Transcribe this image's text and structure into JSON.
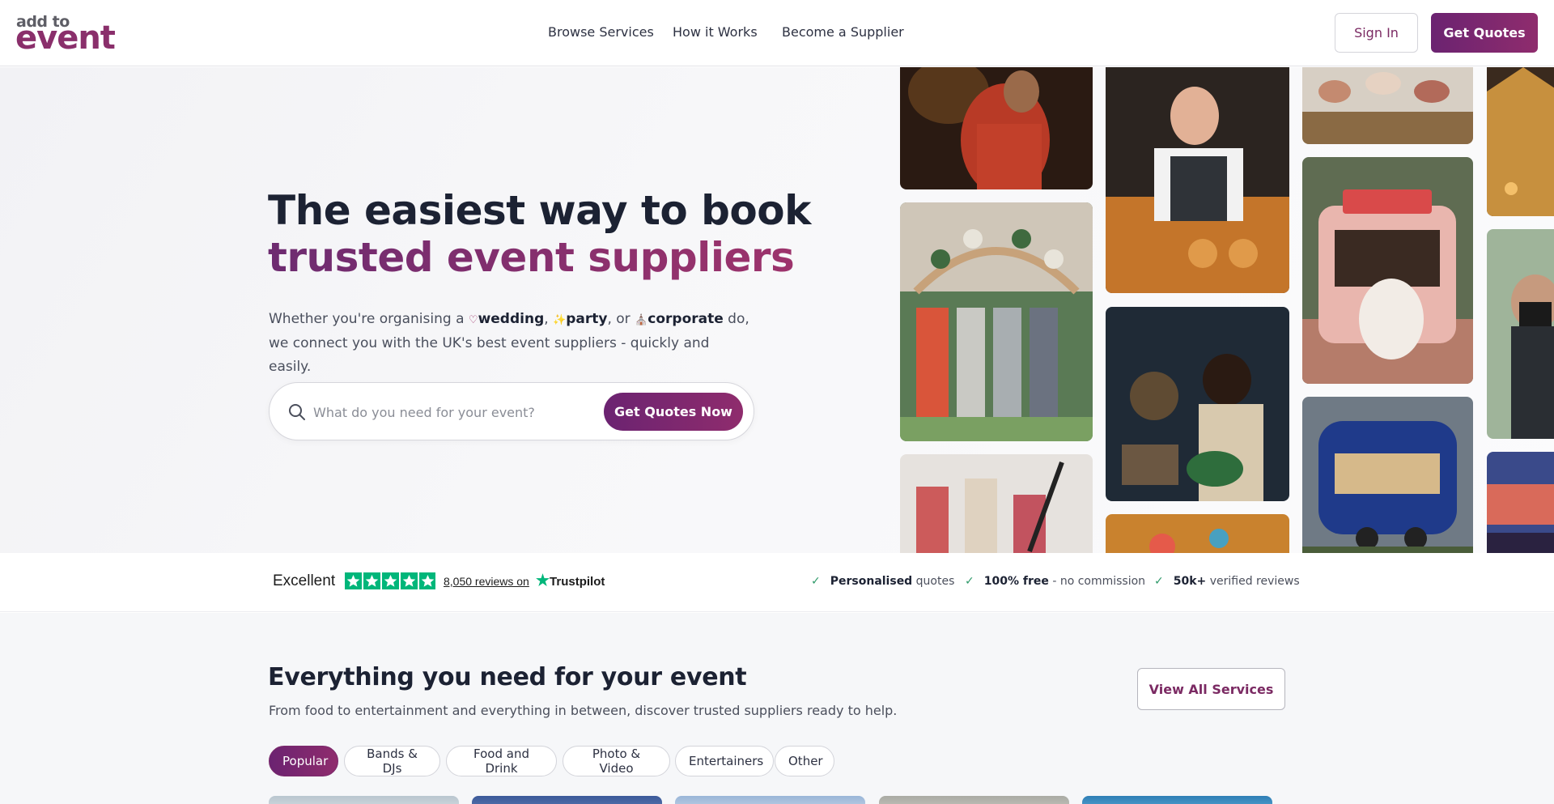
{
  "header": {
    "logo_top": "add to",
    "logo_bottom": "event",
    "nav": [
      "Browse Services",
      "How it Works",
      "Become a Supplier"
    ],
    "sign_in": "Sign In",
    "get_quotes": "Get Quotes"
  },
  "hero": {
    "title_line1": "The easiest way to book",
    "title_line2": "trusted event suppliers",
    "sub_part1": "Whether you're organising a",
    "kw_wedding": "wedding",
    "comma1": ",",
    "kw_party": "party",
    "sub_part2": ", or",
    "kw_corporate": "corporate",
    "sub_part3": "do, we connect you with the UK's best event suppliers - quickly and easily.",
    "search_placeholder": "What do you need for your event?",
    "search_button": "Get Quotes Now",
    "icons": [
      "heart-icon",
      "party-popper-icon",
      "building-icon",
      "search-icon"
    ]
  },
  "trust": {
    "rating_word": "Excellent",
    "reviews": "8,050 reviews on",
    "brand": "Trustpilot",
    "features": [
      {
        "bold": "Personalised",
        "rest": "quotes"
      },
      {
        "bold": "100% free",
        "rest": "- no commission"
      },
      {
        "bold": "50k+",
        "rest": "verified reviews"
      }
    ]
  },
  "services": {
    "title": "Everything you need for your event",
    "subtitle": "From food to entertainment and everything in between, discover trusted suppliers ready to help.",
    "view_all": "View All Services",
    "tabs": [
      "Popular",
      "Bands & DJs",
      "Food and Drink",
      "Photo & Video",
      "Entertainers",
      "Other"
    ],
    "active_tab": "Popular"
  },
  "colors": {
    "brand": "#8a2f6b",
    "brand_dark": "#6b2371",
    "trustpilot_green": "#00b67a"
  }
}
